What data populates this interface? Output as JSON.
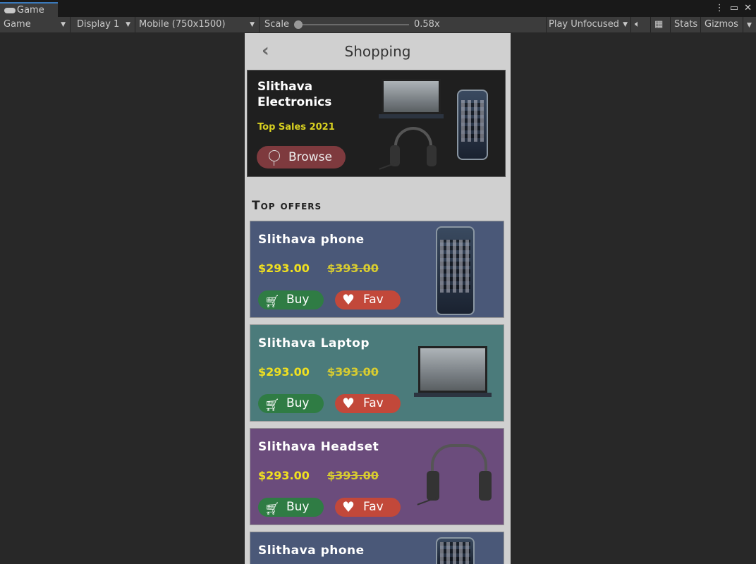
{
  "editor": {
    "tab_label": "Game",
    "menu_icons": [
      "more-icon",
      "maximize-icon",
      "close-icon"
    ],
    "toolbar": {
      "view": "Game",
      "display": "Display 1",
      "resolution": "Mobile (750x1500)",
      "scale_label": "Scale",
      "scale_value": "0.58x",
      "scale_fraction": 0.0,
      "play_mode": "Play Unfocused",
      "stats": "Stats",
      "gizmos": "Gizmos"
    }
  },
  "app": {
    "title": "Shopping",
    "banner": {
      "title_line1": "Slithava",
      "title_line2": "Electronics",
      "subtitle": "Top Sales 2021",
      "browse_label": "Browse"
    },
    "section_title": "Top offers",
    "cards": [
      {
        "title": "Slithava phone",
        "price": "$293.00",
        "old_price": "$393.00",
        "buy": "Buy",
        "fav": "Fav",
        "color": "#4a5878",
        "product": "phone"
      },
      {
        "title": "Slithava Laptop",
        "price": "$293.00",
        "old_price": "$393.00",
        "buy": "Buy",
        "fav": "Fav",
        "color": "#4b7b7b",
        "product": "laptop"
      },
      {
        "title": "Slithava Headset",
        "price": "$293.00",
        "old_price": "$393.00",
        "buy": "Buy",
        "fav": "Fav",
        "color": "#6b4c7c",
        "product": "headset"
      },
      {
        "title": "Slithava phone",
        "color": "#4a5878",
        "product": "phone"
      }
    ]
  }
}
